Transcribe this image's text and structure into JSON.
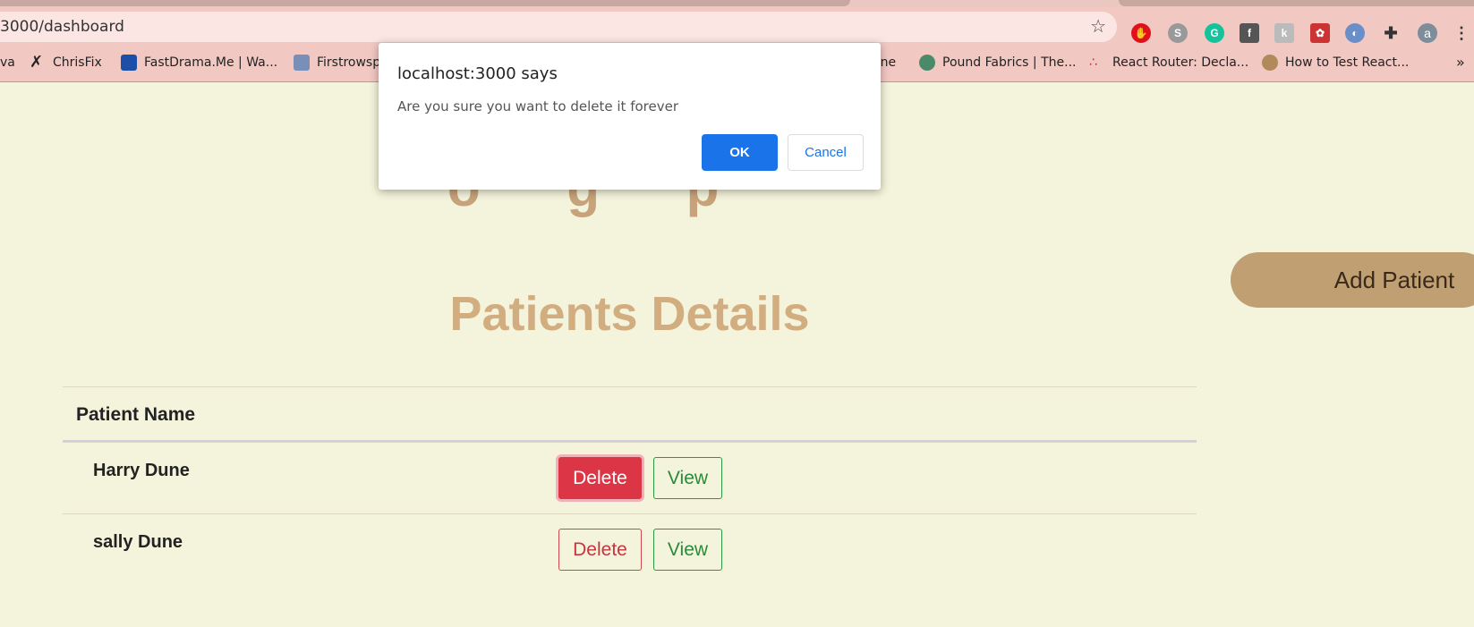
{
  "browser": {
    "url": "3000/dashboard",
    "extensions": [
      {
        "name": "adblock-icon",
        "color": "#e0111b",
        "glyph": "✋"
      },
      {
        "name": "extension-gray-icon",
        "color": "#888888",
        "glyph": "S"
      },
      {
        "name": "grammarly-icon",
        "color": "#15c39a",
        "glyph": "G"
      },
      {
        "name": "facebook-extension-icon",
        "color": "#555555",
        "glyph": "f"
      },
      {
        "name": "extension-k-icon",
        "color": "#aaaaaa",
        "glyph": "k"
      },
      {
        "name": "extension-red-icon",
        "color": "#cc3333",
        "glyph": "✿"
      },
      {
        "name": "extension-blue-icon",
        "color": "#6a8ec8",
        "glyph": "◐"
      },
      {
        "name": "puzzle-icon",
        "color": "#333333",
        "glyph": "✚"
      }
    ],
    "profile_initial": "a",
    "bookmarks": [
      {
        "label": "va",
        "color": "#f2c8c3"
      },
      {
        "label": "ChrisFix",
        "color": "#222222"
      },
      {
        "label": "FastDrama.Me | Wa...",
        "color": "#1e4fa8"
      },
      {
        "label": "Firstrowsp",
        "color": "#7a8fb8"
      },
      {
        "label": "ane",
        "color": "#f2c8c3"
      },
      {
        "label": "Pound Fabrics | The...",
        "color": "#4a8a6a"
      },
      {
        "label": "React Router: Decla...",
        "color": "#c81e3a"
      },
      {
        "label": "How to Test React...",
        "color": "#b08a5a"
      }
    ],
    "overflow": "»"
  },
  "page": {
    "heading_fragment": "o g p",
    "add_button": "Add Patient",
    "section_title": "Patients Details",
    "table": {
      "column": "Patient Name",
      "rows": [
        {
          "name": "Harry Dune",
          "delete": "Delete",
          "view": "View"
        },
        {
          "name": "sally Dune",
          "delete": "Delete",
          "view": "View"
        }
      ]
    }
  },
  "dialog": {
    "origin": "localhost:3000 says",
    "message": "Are you sure you want to delete it forever",
    "ok": "OK",
    "cancel": "Cancel"
  }
}
